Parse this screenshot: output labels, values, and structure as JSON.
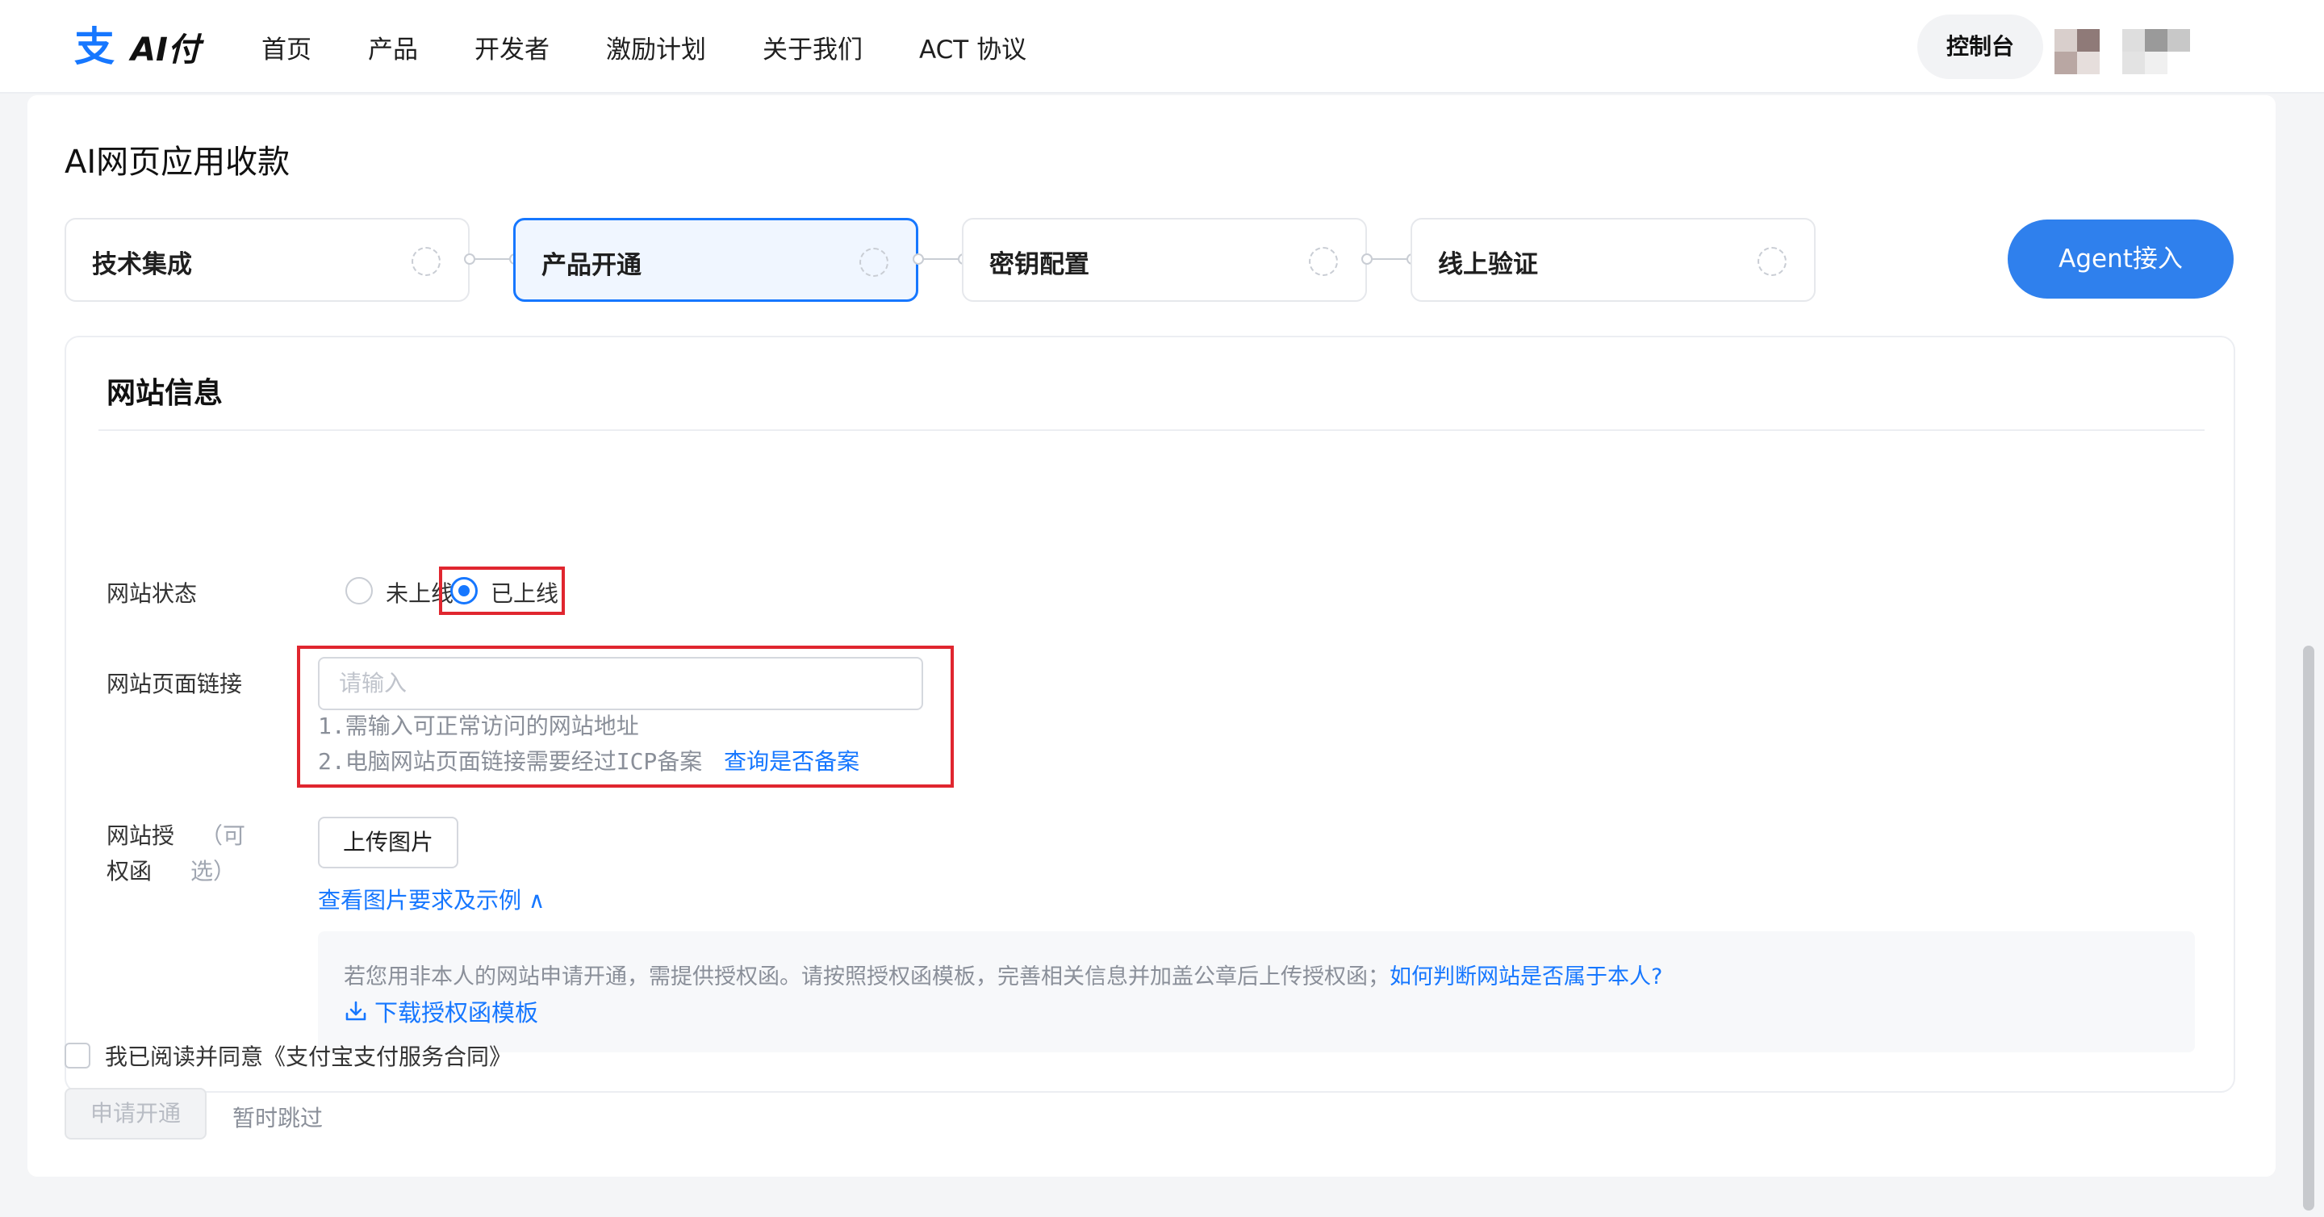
{
  "header": {
    "logo_text": "AI付",
    "nav": [
      "首页",
      "产品",
      "开发者",
      "激励计划",
      "关于我们",
      "ACT 协议"
    ],
    "console_label": "控制台"
  },
  "page": {
    "title": "AI网页应用收款",
    "steps": [
      "技术集成",
      "产品开通",
      "密钥配置",
      "线上验证"
    ],
    "active_step": "产品开通",
    "agent_button": "Agent接入"
  },
  "panel": {
    "title": "网站信息",
    "status": {
      "label": "网站状态",
      "options": [
        "未上线",
        "已上线"
      ],
      "selected": "已上线"
    },
    "url": {
      "label": "网站页面链接",
      "placeholder": "请输入",
      "value": "",
      "hint1": "1.需输入可正常访问的网站地址",
      "hint2": "2.电脑网站页面链接需要经过ICP备案",
      "hint2_link": "查询是否备案"
    },
    "auth": {
      "label_line1": "网站授",
      "label_line2": "权函",
      "optional_line1": "（可",
      "optional_line2": "选）",
      "upload_label": "上传图片",
      "toggle_link": "查看图片要求及示例 ∧",
      "tip": "若您用非本人的网站申请开通，需提供授权函。请按照授权函模板，完善相关信息并加盖公章后上传授权函；",
      "tip_link": "如何判断网站是否属于本人?",
      "download": "下载授权函模板"
    }
  },
  "footer": {
    "agree_prefix": "我已阅读并同意",
    "agree_link": "《支付宝支付服务合同》",
    "apply_label": "申请开通",
    "skip_label": "暂时跳过"
  },
  "colors": {
    "accent": "#1677ff",
    "agent_button": "#2f80ed",
    "highlight": "#e0262f"
  }
}
